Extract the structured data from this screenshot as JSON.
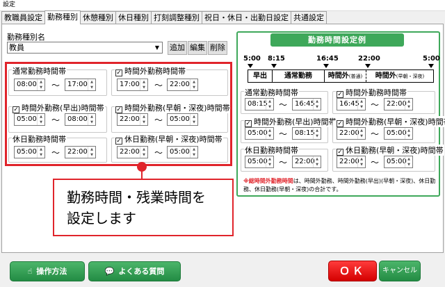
{
  "window": {
    "title": "設定"
  },
  "tabs": [
    "教職員設定",
    "勤務種別",
    "休憩種別",
    "休日種別",
    "打刻調整種別",
    "祝日・休日・出勤日設定",
    "共通設定"
  ],
  "work_type": {
    "label": "勤務種別名",
    "value": "教員",
    "add": "追加",
    "edit": "編集",
    "delete": "削除"
  },
  "groups": {
    "normal": {
      "title": "通常勤務時間帯",
      "start": "08:00",
      "end": "17:00"
    },
    "overtime": {
      "title": "時間外勤務時間帯",
      "start": "17:00",
      "end": "22:00"
    },
    "early": {
      "title": "時間外勤務(早出)時間帯",
      "start": "05:00",
      "end": "08:00"
    },
    "late": {
      "title": "時間外勤務(早朝・深夜)時間帯",
      "start": "22:00",
      "end": "05:00"
    },
    "holiday": {
      "title": "休日勤務時間帯",
      "start": "05:00",
      "end": "22:00"
    },
    "holiday_late": {
      "title": "休日勤務(早朝・深夜)時間帯",
      "start": "22:00",
      "end": "05:00"
    }
  },
  "tilde": "〜",
  "callout": {
    "line1": "勤務時間・残業時間を",
    "line2": "設定します"
  },
  "example": {
    "title": "勤務時間設定例",
    "times": [
      "5:00",
      "8:15",
      "16:45",
      "22:00",
      "5:00"
    ],
    "segments": [
      "早出",
      "通常勤務",
      "時間外",
      "(普通)",
      "時間外",
      "(早朝・深夜)"
    ],
    "normal": {
      "title": "通常勤務時間帯",
      "start": "08:15",
      "end": "16:45"
    },
    "overtime": {
      "title": "時間外勤務時間帯",
      "start": "16:45",
      "end": "22:00"
    },
    "early": {
      "title": "時間外勤務(早出)時間帯",
      "start": "05:00",
      "end": "08:15"
    },
    "late": {
      "title": "時間外勤務(早朝・深夜)時間帯",
      "start": "22:00",
      "end": "05:00"
    },
    "holiday": {
      "title": "休日勤務時間帯",
      "start": "05:00",
      "end": "22:00"
    },
    "holiday_late": {
      "title": "休日勤務(早朝・深夜)時間帯",
      "start": "22:00",
      "end": "05:00"
    },
    "note_red": "※総時間外勤務時間",
    "note_rest": "は、時間外勤務、時間外勤務(早出)(早朝・深夜)、休日勤務、休日勤務(早朝・深夜)の合計です。"
  },
  "footer": {
    "howto": "操作方法",
    "faq": "よくある質問",
    "ok": "ＯＫ",
    "cancel": "キャンセル"
  },
  "colors": {
    "accent_green": "#3ea85a",
    "alert_red": "#e0242b"
  }
}
